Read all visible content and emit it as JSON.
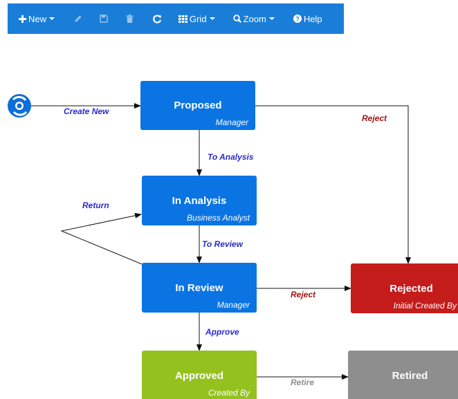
{
  "toolbar": {
    "new_label": "New",
    "grid_label": "Grid",
    "zoom_label": "Zoom",
    "help_label": "Help",
    "background": "#1a7ed8"
  },
  "workflow": {
    "states": [
      {
        "id": "proposed",
        "name": "Proposed",
        "role": "Manager",
        "color": "#0b74e3"
      },
      {
        "id": "in_analysis",
        "name": "In Analysis",
        "role": "Business Analyst",
        "color": "#0b74e3"
      },
      {
        "id": "in_review",
        "name": "In Review",
        "role": "Manager",
        "color": "#0b74e3"
      },
      {
        "id": "rejected",
        "name": "Rejected",
        "role": "Initial Created By",
        "color": "#c41b1b"
      },
      {
        "id": "approved",
        "name": "Approved",
        "role": "Created By",
        "color": "#95c11f"
      },
      {
        "id": "retired",
        "name": "Retired",
        "role": "",
        "color": "#8e8e8e"
      }
    ],
    "transitions": [
      {
        "from": "start",
        "to": "proposed",
        "label": "Create New",
        "color": "#2a2acc"
      },
      {
        "from": "proposed",
        "to": "in_analysis",
        "label": "To Analysis",
        "color": "#2a2acc"
      },
      {
        "from": "proposed",
        "to": "rejected",
        "label": "Reject",
        "color": "#a11414"
      },
      {
        "from": "in_review",
        "to": "in_analysis",
        "label": "Return",
        "color": "#2a2acc"
      },
      {
        "from": "in_analysis",
        "to": "in_review",
        "label": "To Review",
        "color": "#2a2acc"
      },
      {
        "from": "in_review",
        "to": "rejected",
        "label": "Reject",
        "color": "#a11414"
      },
      {
        "from": "in_review",
        "to": "approved",
        "label": "Approve",
        "color": "#2a2acc"
      },
      {
        "from": "approved",
        "to": "retired",
        "label": "Retire",
        "color": "#8e8e8e"
      }
    ]
  }
}
